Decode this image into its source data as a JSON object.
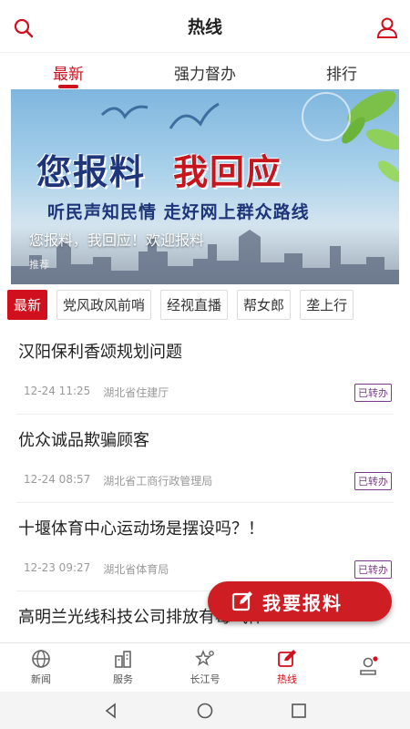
{
  "header": {
    "title": "热线",
    "search_icon": "search-icon",
    "user_icon": "user-icon"
  },
  "tabs": [
    {
      "label": "最新",
      "active": true
    },
    {
      "label": "强力督办",
      "active": false
    },
    {
      "label": "排行",
      "active": false
    }
  ],
  "banner": {
    "headline_left": "您报料",
    "headline_right": "我回应",
    "slogan": "听民声知民情  走好网上群众路线",
    "caption": "您报料，我回应！欢迎报料",
    "tag": "推荐"
  },
  "chips": [
    {
      "label": "最新",
      "active": true
    },
    {
      "label": "党风政风前哨",
      "active": false
    },
    {
      "label": "经视直播",
      "active": false
    },
    {
      "label": "帮女郎",
      "active": false
    },
    {
      "label": "垄上行",
      "active": false
    }
  ],
  "items": [
    {
      "title": "汉阳保利香颂规划问题",
      "time": "12-24 11:25",
      "dept": "湖北省住建厅",
      "status": "已转办"
    },
    {
      "title": "优众诚品欺骗顾客",
      "time": "12-24 08:57",
      "dept": "湖北省工商行政管理局",
      "status": "已转办"
    },
    {
      "title": "十堰体育中心运动场是摆设吗？！",
      "time": "12-23 09:27",
      "dept": "湖北省体育局",
      "status": "已转办"
    },
    {
      "title": "高明兰光线科技公司排放有毒气体",
      "time": "",
      "dept": "",
      "status": ""
    }
  ],
  "report_button": {
    "label": "我要报料",
    "icon": "edit-icon"
  },
  "bottom_nav": [
    {
      "label": "新闻",
      "icon": "globe-icon",
      "active": false
    },
    {
      "label": "服务",
      "icon": "buildings-icon",
      "active": false
    },
    {
      "label": "长江号",
      "icon": "star-icon",
      "active": false
    },
    {
      "label": "热线",
      "icon": "edit-icon",
      "active": true
    },
    {
      "label": "",
      "icon": "profile-icon",
      "active": false
    }
  ],
  "system_bar": {
    "back_icon": "back-icon",
    "home_icon": "home-icon",
    "recents_icon": "recents-icon"
  },
  "colors": {
    "accent": "#d0101c",
    "badge": "#7a3a8a"
  }
}
